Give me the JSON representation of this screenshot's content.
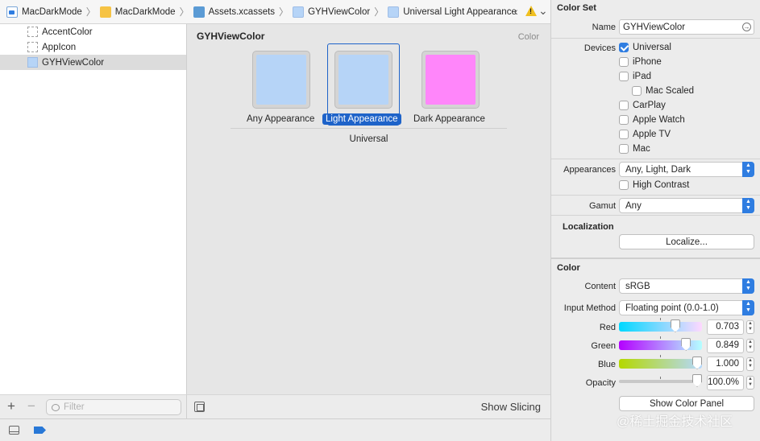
{
  "breadcrumb": {
    "items": [
      "MacDarkMode",
      "MacDarkMode",
      "Assets.xcassets",
      "GYHViewColor",
      "Universal Light Appearance"
    ]
  },
  "sidebar": {
    "items": [
      {
        "label": "AccentColor"
      },
      {
        "label": "AppIcon"
      },
      {
        "label": "GYHViewColor"
      }
    ],
    "filter_placeholder": "Filter"
  },
  "editor": {
    "title": "GYHViewColor",
    "kind": "Color",
    "wells": [
      {
        "label": "Any Appearance",
        "color": "#b6d4f7"
      },
      {
        "label": "Light Appearance",
        "color": "#b6d4f7"
      },
      {
        "label": "Dark Appearance",
        "color": "#ff86fa"
      }
    ],
    "group_label": "Universal",
    "show_slicing": "Show Slicing"
  },
  "inspector": {
    "color_set_title": "Color Set",
    "name_label": "Name",
    "name_value": "GYHViewColor",
    "devices_label": "Devices",
    "devices": [
      {
        "label": "Universal",
        "checked": true
      },
      {
        "label": "iPhone",
        "checked": false
      },
      {
        "label": "iPad",
        "checked": false
      },
      {
        "label": "Mac Scaled",
        "checked": false
      },
      {
        "label": "CarPlay",
        "checked": false
      },
      {
        "label": "Apple Watch",
        "checked": false
      },
      {
        "label": "Apple TV",
        "checked": false
      },
      {
        "label": "Mac",
        "checked": false
      }
    ],
    "appearances_label": "Appearances",
    "appearances_value": "Any, Light, Dark",
    "high_contrast_label": "High Contrast",
    "gamut_label": "Gamut",
    "gamut_value": "Any",
    "localization_title": "Localization",
    "localize_button": "Localize...",
    "color_title": "Color",
    "content_label": "Content",
    "content_value": "sRGB",
    "input_method_label": "Input Method",
    "input_method_value": "Floating point (0.0-1.0)",
    "channels": [
      {
        "label": "Red",
        "value": "0.703",
        "fraction": 0.703
      },
      {
        "label": "Green",
        "value": "0.849",
        "fraction": 0.849
      },
      {
        "label": "Blue",
        "value": "1.000",
        "fraction": 1.0
      },
      {
        "label": "Opacity",
        "value": "100.0%",
        "fraction": 1.0
      }
    ],
    "show_color_panel": "Show Color Panel"
  },
  "watermark": "@稀土掘金技术社区"
}
